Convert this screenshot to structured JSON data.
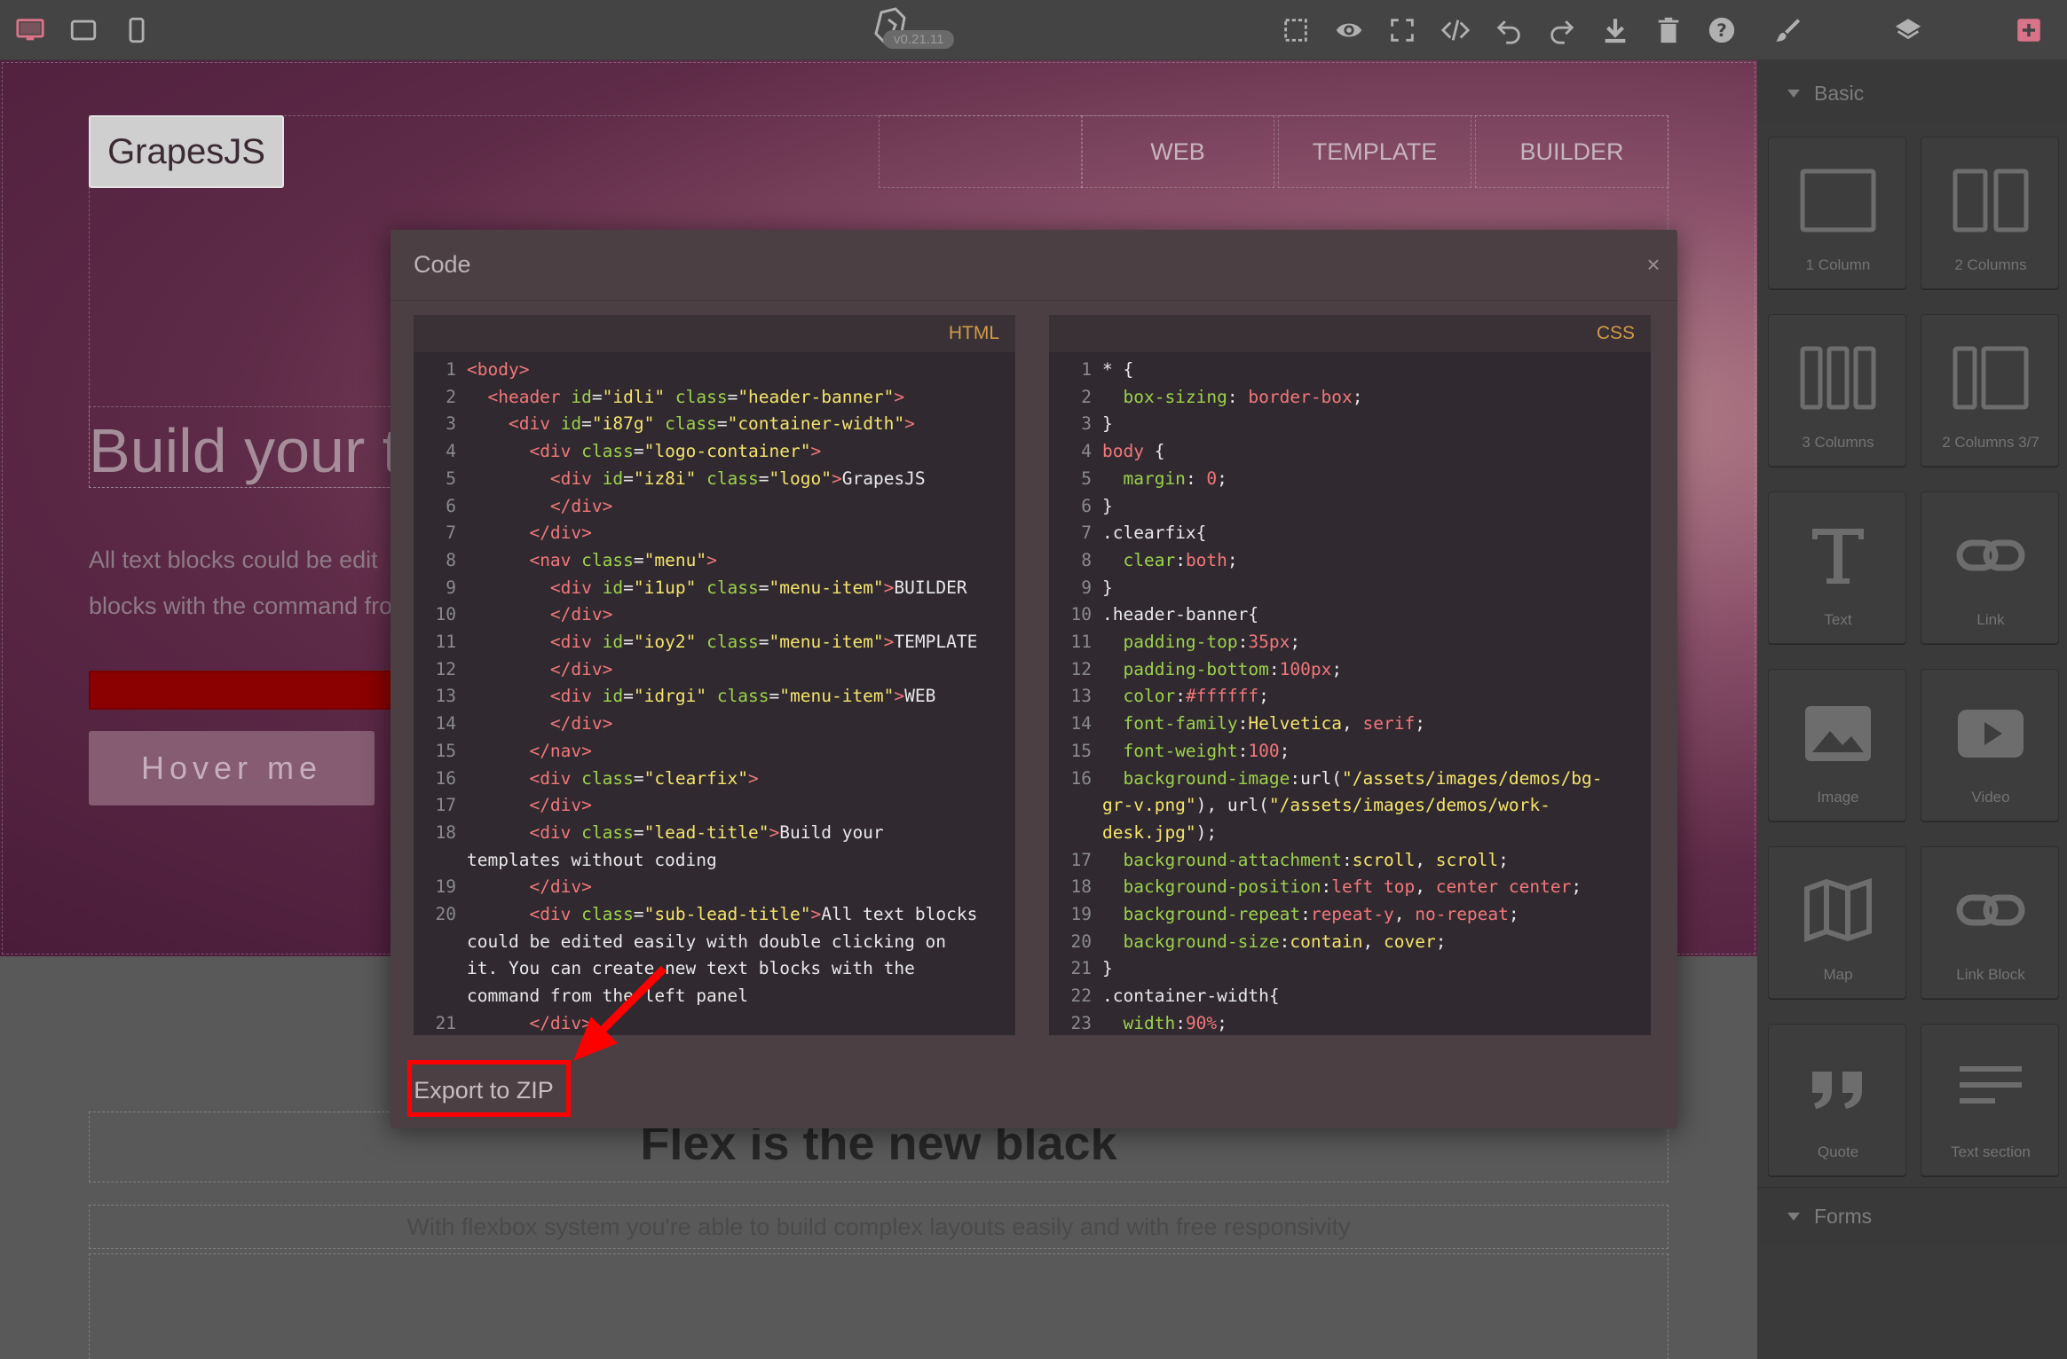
{
  "topbar": {
    "devices": [
      {
        "name": "desktop-icon",
        "color": "#d9738a"
      },
      {
        "name": "tablet-icon",
        "color": "#b0b0b0"
      },
      {
        "name": "mobile-icon",
        "color": "#b0b0b0"
      }
    ],
    "version": "v0.21.11",
    "tools": [
      "sw-visibility-icon",
      "preview-icon",
      "fullscreen-icon",
      "code-icon",
      "undo-icon",
      "redo-icon",
      "download-icon",
      "trash-icon",
      "help-icon"
    ],
    "panels": [
      "brush-icon",
      "layers-icon",
      "blocks-icon"
    ]
  },
  "canvas": {
    "logo": "GrapesJS",
    "menu": [
      "WEB",
      "TEMPLATE",
      "BUILDER"
    ],
    "lead_title": "Build your t",
    "sub_lead_line1": "All text blocks could be edit",
    "sub_lead_line2": "blocks with the command fro",
    "hover_button": "Hover me",
    "flex_title": "Flex is the new black",
    "flex_subtitle": "With flexbox system you're able to build complex layouts easily and with free responsivity"
  },
  "modal": {
    "title": "Code",
    "close": "×",
    "html_label": "HTML",
    "css_label": "CSS",
    "export_button": "Export to ZIP"
  },
  "html_code": [
    {
      "n": "1",
      "segs": [
        [
          "t",
          "<body>"
        ]
      ]
    },
    {
      "n": "2",
      "segs": [
        [
          "x",
          "  "
        ],
        [
          "t",
          "<header"
        ],
        [
          "x",
          " "
        ],
        [
          "a",
          "id"
        ],
        [
          "x",
          "="
        ],
        [
          "s",
          "\"idli\""
        ],
        [
          "x",
          " "
        ],
        [
          "a",
          "class"
        ],
        [
          "x",
          "="
        ],
        [
          "s",
          "\"header-banner\""
        ],
        [
          "t",
          ">"
        ]
      ]
    },
    {
      "n": "3",
      "segs": [
        [
          "x",
          "    "
        ],
        [
          "t",
          "<div"
        ],
        [
          "x",
          " "
        ],
        [
          "a",
          "id"
        ],
        [
          "x",
          "="
        ],
        [
          "s",
          "\"i87g\""
        ],
        [
          "x",
          " "
        ],
        [
          "a",
          "class"
        ],
        [
          "x",
          "="
        ],
        [
          "s",
          "\"container-width\""
        ],
        [
          "t",
          ">"
        ]
      ]
    },
    {
      "n": "4",
      "segs": [
        [
          "x",
          "      "
        ],
        [
          "t",
          "<div"
        ],
        [
          "x",
          " "
        ],
        [
          "a",
          "class"
        ],
        [
          "x",
          "="
        ],
        [
          "s",
          "\"logo-container\""
        ],
        [
          "t",
          ">"
        ]
      ]
    },
    {
      "n": "5",
      "segs": [
        [
          "x",
          "        "
        ],
        [
          "t",
          "<div"
        ],
        [
          "x",
          " "
        ],
        [
          "a",
          "id"
        ],
        [
          "x",
          "="
        ],
        [
          "s",
          "\"iz8i\""
        ],
        [
          "x",
          " "
        ],
        [
          "a",
          "class"
        ],
        [
          "x",
          "="
        ],
        [
          "s",
          "\"logo\""
        ],
        [
          "t",
          ">"
        ],
        [
          "x",
          "GrapesJS"
        ]
      ]
    },
    {
      "n": "6",
      "segs": [
        [
          "x",
          "        "
        ],
        [
          "t",
          "</div>"
        ]
      ]
    },
    {
      "n": "7",
      "segs": [
        [
          "x",
          "      "
        ],
        [
          "t",
          "</div>"
        ]
      ]
    },
    {
      "n": "8",
      "segs": [
        [
          "x",
          "      "
        ],
        [
          "t",
          "<nav"
        ],
        [
          "x",
          " "
        ],
        [
          "a",
          "class"
        ],
        [
          "x",
          "="
        ],
        [
          "s",
          "\"menu\""
        ],
        [
          "t",
          ">"
        ]
      ]
    },
    {
      "n": "9",
      "segs": [
        [
          "x",
          "        "
        ],
        [
          "t",
          "<div"
        ],
        [
          "x",
          " "
        ],
        [
          "a",
          "id"
        ],
        [
          "x",
          "="
        ],
        [
          "s",
          "\"i1up\""
        ],
        [
          "x",
          " "
        ],
        [
          "a",
          "class"
        ],
        [
          "x",
          "="
        ],
        [
          "s",
          "\"menu-item\""
        ],
        [
          "t",
          ">"
        ],
        [
          "x",
          "BUILDER"
        ]
      ]
    },
    {
      "n": "10",
      "segs": [
        [
          "x",
          "        "
        ],
        [
          "t",
          "</div>"
        ]
      ]
    },
    {
      "n": "11",
      "segs": [
        [
          "x",
          "        "
        ],
        [
          "t",
          "<div"
        ],
        [
          "x",
          " "
        ],
        [
          "a",
          "id"
        ],
        [
          "x",
          "="
        ],
        [
          "s",
          "\"ioy2\""
        ],
        [
          "x",
          " "
        ],
        [
          "a",
          "class"
        ],
        [
          "x",
          "="
        ],
        [
          "s",
          "\"menu-item\""
        ],
        [
          "t",
          ">"
        ],
        [
          "x",
          "TEMPLATE"
        ]
      ]
    },
    {
      "n": "12",
      "segs": [
        [
          "x",
          "        "
        ],
        [
          "t",
          "</div>"
        ]
      ]
    },
    {
      "n": "13",
      "segs": [
        [
          "x",
          "        "
        ],
        [
          "t",
          "<div"
        ],
        [
          "x",
          " "
        ],
        [
          "a",
          "id"
        ],
        [
          "x",
          "="
        ],
        [
          "s",
          "\"idrgi\""
        ],
        [
          "x",
          " "
        ],
        [
          "a",
          "class"
        ],
        [
          "x",
          "="
        ],
        [
          "s",
          "\"menu-item\""
        ],
        [
          "t",
          ">"
        ],
        [
          "x",
          "WEB"
        ]
      ]
    },
    {
      "n": "14",
      "segs": [
        [
          "x",
          "        "
        ],
        [
          "t",
          "</div>"
        ]
      ]
    },
    {
      "n": "15",
      "segs": [
        [
          "x",
          "      "
        ],
        [
          "t",
          "</nav>"
        ]
      ]
    },
    {
      "n": "16",
      "segs": [
        [
          "x",
          "      "
        ],
        [
          "t",
          "<div"
        ],
        [
          "x",
          " "
        ],
        [
          "a",
          "class"
        ],
        [
          "x",
          "="
        ],
        [
          "s",
          "\"clearfix\""
        ],
        [
          "t",
          ">"
        ]
      ]
    },
    {
      "n": "17",
      "segs": [
        [
          "x",
          "      "
        ],
        [
          "t",
          "</div>"
        ]
      ]
    },
    {
      "n": "18",
      "segs": [
        [
          "x",
          "      "
        ],
        [
          "t",
          "<div"
        ],
        [
          "x",
          " "
        ],
        [
          "a",
          "class"
        ],
        [
          "x",
          "="
        ],
        [
          "s",
          "\"lead-title\""
        ],
        [
          "t",
          ">"
        ],
        [
          "x",
          "Build your"
        ]
      ]
    },
    {
      "n": "",
      "segs": [
        [
          "x",
          "templates without coding"
        ]
      ]
    },
    {
      "n": "19",
      "segs": [
        [
          "x",
          "      "
        ],
        [
          "t",
          "</div>"
        ]
      ]
    },
    {
      "n": "20",
      "segs": [
        [
          "x",
          "      "
        ],
        [
          "t",
          "<div"
        ],
        [
          "x",
          " "
        ],
        [
          "a",
          "class"
        ],
        [
          "x",
          "="
        ],
        [
          "s",
          "\"sub-lead-title\""
        ],
        [
          "t",
          ">"
        ],
        [
          "x",
          "All text blocks"
        ]
      ]
    },
    {
      "n": "",
      "segs": [
        [
          "x",
          "could be edited easily with double clicking on"
        ]
      ]
    },
    {
      "n": "",
      "segs": [
        [
          "x",
          "it. You can create new text blocks with the"
        ]
      ]
    },
    {
      "n": "",
      "segs": [
        [
          "x",
          "command from the left panel"
        ]
      ]
    },
    {
      "n": "21",
      "segs": [
        [
          "x",
          "      "
        ],
        [
          "t",
          "</div>"
        ]
      ]
    }
  ],
  "css_code": [
    {
      "n": "1",
      "segs": [
        [
          "x",
          "* {"
        ]
      ]
    },
    {
      "n": "2",
      "segs": [
        [
          "x",
          "  "
        ],
        [
          "a",
          "box-sizing"
        ],
        [
          "x",
          ": "
        ],
        [
          "v",
          "border-box"
        ],
        [
          "x",
          ";"
        ]
      ]
    },
    {
      "n": "3",
      "segs": [
        [
          "x",
          "}"
        ]
      ]
    },
    {
      "n": "4",
      "segs": [
        [
          "t",
          "body"
        ],
        [
          "x",
          " {"
        ]
      ]
    },
    {
      "n": "5",
      "segs": [
        [
          "x",
          "  "
        ],
        [
          "a",
          "margin"
        ],
        [
          "x",
          ": "
        ],
        [
          "v",
          "0"
        ],
        [
          "x",
          ";"
        ]
      ]
    },
    {
      "n": "6",
      "segs": [
        [
          "x",
          "}"
        ]
      ]
    },
    {
      "n": "7",
      "segs": [
        [
          "x",
          ".clearfix{"
        ]
      ]
    },
    {
      "n": "8",
      "segs": [
        [
          "x",
          "  "
        ],
        [
          "a",
          "clear"
        ],
        [
          "x",
          ":"
        ],
        [
          "v",
          "both"
        ],
        [
          "x",
          ";"
        ]
      ]
    },
    {
      "n": "9",
      "segs": [
        [
          "x",
          "}"
        ]
      ]
    },
    {
      "n": "10",
      "segs": [
        [
          "x",
          ".header-banner{"
        ]
      ]
    },
    {
      "n": "11",
      "segs": [
        [
          "x",
          "  "
        ],
        [
          "a",
          "padding-top"
        ],
        [
          "x",
          ":"
        ],
        [
          "v",
          "35px"
        ],
        [
          "x",
          ";"
        ]
      ]
    },
    {
      "n": "12",
      "segs": [
        [
          "x",
          "  "
        ],
        [
          "a",
          "padding-bottom"
        ],
        [
          "x",
          ":"
        ],
        [
          "v",
          "100px"
        ],
        [
          "x",
          ";"
        ]
      ]
    },
    {
      "n": "13",
      "segs": [
        [
          "x",
          "  "
        ],
        [
          "a",
          "color"
        ],
        [
          "x",
          ":"
        ],
        [
          "v",
          "#ffffff"
        ],
        [
          "x",
          ";"
        ]
      ]
    },
    {
      "n": "14",
      "segs": [
        [
          "x",
          "  "
        ],
        [
          "a",
          "font-family"
        ],
        [
          "x",
          ":"
        ],
        [
          "s",
          "Helvetica"
        ],
        [
          "x",
          ", "
        ],
        [
          "v",
          "serif"
        ],
        [
          "x",
          ";"
        ]
      ]
    },
    {
      "n": "15",
      "segs": [
        [
          "x",
          "  "
        ],
        [
          "a",
          "font-weight"
        ],
        [
          "x",
          ":"
        ],
        [
          "v",
          "100"
        ],
        [
          "x",
          ";"
        ]
      ]
    },
    {
      "n": "16",
      "segs": [
        [
          "x",
          "  "
        ],
        [
          "a",
          "background-image"
        ],
        [
          "x",
          ":url("
        ],
        [
          "s",
          "\"/assets/images/demos/bg-"
        ]
      ]
    },
    {
      "n": "",
      "segs": [
        [
          "s",
          "gr-v.png\""
        ],
        [
          "x",
          "), url("
        ],
        [
          "s",
          "\"/assets/images/demos/work-"
        ]
      ]
    },
    {
      "n": "",
      "segs": [
        [
          "s",
          "desk.jpg\""
        ],
        [
          "x",
          ");"
        ]
      ]
    },
    {
      "n": "17",
      "segs": [
        [
          "x",
          "  "
        ],
        [
          "a",
          "background-attachment"
        ],
        [
          "x",
          ":"
        ],
        [
          "s",
          "scroll"
        ],
        [
          "x",
          ", "
        ],
        [
          "s",
          "scroll"
        ],
        [
          "x",
          ";"
        ]
      ]
    },
    {
      "n": "18",
      "segs": [
        [
          "x",
          "  "
        ],
        [
          "a",
          "background-position"
        ],
        [
          "x",
          ":"
        ],
        [
          "v",
          "left top"
        ],
        [
          "x",
          ", "
        ],
        [
          "v",
          "center center"
        ],
        [
          "x",
          ";"
        ]
      ]
    },
    {
      "n": "19",
      "segs": [
        [
          "x",
          "  "
        ],
        [
          "a",
          "background-repeat"
        ],
        [
          "x",
          ":"
        ],
        [
          "v",
          "repeat-y"
        ],
        [
          "x",
          ", "
        ],
        [
          "v",
          "no-repeat"
        ],
        [
          "x",
          ";"
        ]
      ]
    },
    {
      "n": "20",
      "segs": [
        [
          "x",
          "  "
        ],
        [
          "a",
          "background-size"
        ],
        [
          "x",
          ":"
        ],
        [
          "s",
          "contain"
        ],
        [
          "x",
          ", "
        ],
        [
          "s",
          "cover"
        ],
        [
          "x",
          ";"
        ]
      ]
    },
    {
      "n": "21",
      "segs": [
        [
          "x",
          "}"
        ]
      ]
    },
    {
      "n": "22",
      "segs": [
        [
          "x",
          ".container-width{"
        ]
      ]
    },
    {
      "n": "23",
      "segs": [
        [
          "x",
          "  "
        ],
        [
          "a",
          "width"
        ],
        [
          "x",
          ":"
        ],
        [
          "v",
          "90%"
        ],
        [
          "x",
          ";"
        ]
      ]
    }
  ],
  "sidebar": {
    "basic_title": "Basic",
    "forms_title": "Forms",
    "blocks": [
      {
        "label": "1 Column",
        "icon": "one-column-icon"
      },
      {
        "label": "2 Columns",
        "icon": "two-columns-icon"
      },
      {
        "label": "3 Columns",
        "icon": "three-columns-icon"
      },
      {
        "label": "2 Columns 3/7",
        "icon": "two-columns-37-icon"
      },
      {
        "label": "Text",
        "icon": "text-icon"
      },
      {
        "label": "Link",
        "icon": "link-icon"
      },
      {
        "label": "Image",
        "icon": "image-icon"
      },
      {
        "label": "Video",
        "icon": "video-icon"
      },
      {
        "label": "Map",
        "icon": "map-icon"
      },
      {
        "label": "Link Block",
        "icon": "link-block-icon"
      },
      {
        "label": "Quote",
        "icon": "quote-icon"
      },
      {
        "label": "Text section",
        "icon": "text-section-icon"
      }
    ]
  },
  "annotation": {
    "highlight_color": "#ff0000",
    "target": "Export to ZIP"
  }
}
